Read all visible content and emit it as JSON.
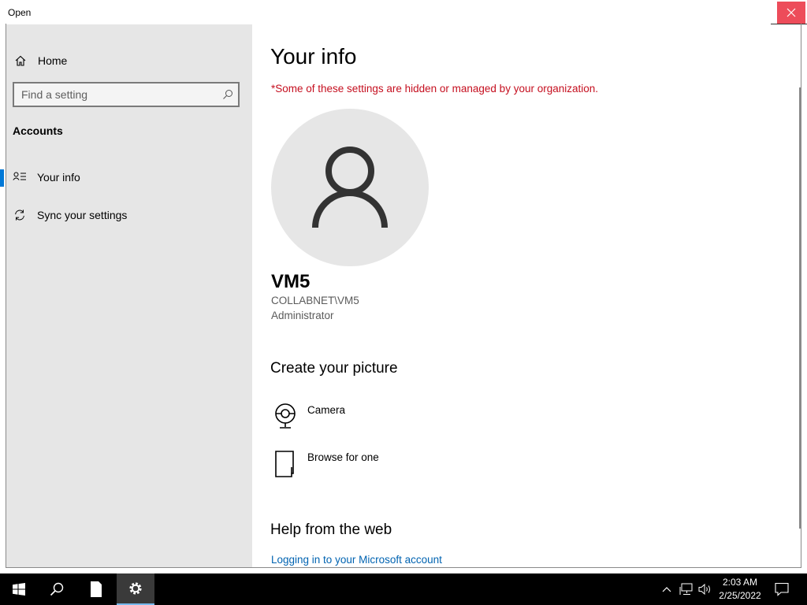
{
  "window": {
    "title": "Open"
  },
  "sidebar": {
    "home_label": "Home",
    "search_placeholder": "Find a setting",
    "section_title": "Accounts",
    "items": [
      {
        "label": "Your info",
        "icon": "contact-card-icon",
        "selected": true
      },
      {
        "label": "Sync your settings",
        "icon": "sync-icon",
        "selected": false
      }
    ]
  },
  "main": {
    "title": "Your info",
    "managed_note": "*Some of these settings are hidden or managed by your organization.",
    "user": {
      "name": "VM5",
      "domain": "COLLABNET\\VM5",
      "role": "Administrator"
    },
    "create_picture": {
      "heading": "Create your picture",
      "options": [
        {
          "label": "Camera",
          "icon": "camera-icon"
        },
        {
          "label": "Browse for one",
          "icon": "document-icon"
        }
      ]
    },
    "help": {
      "heading": "Help from the web",
      "link": "Logging in to your Microsoft account"
    }
  },
  "taskbar": {
    "time": "2:03 AM",
    "date": "2/25/2022"
  },
  "colors": {
    "accent": "#0078d7",
    "warning_text": "#c50f1f",
    "link": "#0063b1",
    "sidebar_bg": "#e6e6e6"
  }
}
